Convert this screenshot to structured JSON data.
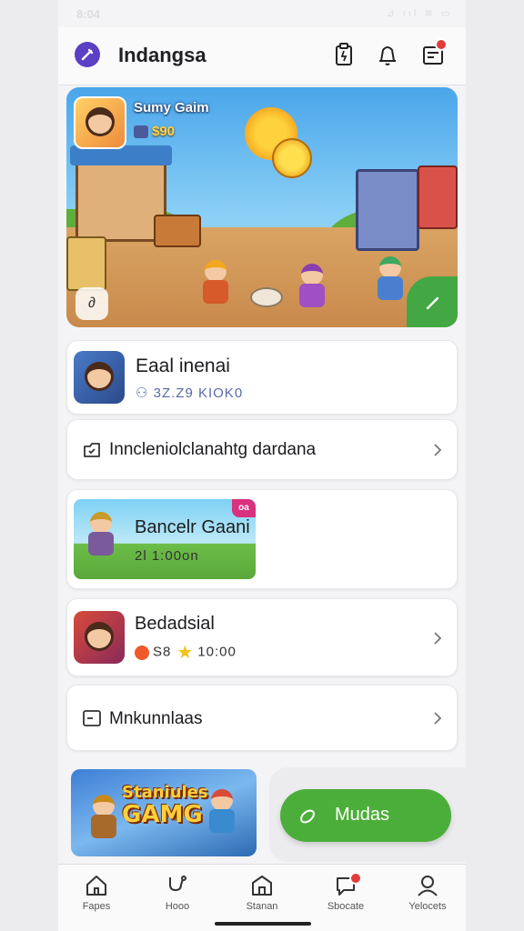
{
  "status_bar": {
    "time": "8:04",
    "icons": "⊿ ııl ≋ ▭"
  },
  "header": {
    "title": "Indangsa"
  },
  "hero": {
    "game_name": "Sumy Gaim",
    "score": "$90",
    "left_button_glyph": "∂"
  },
  "cards": {
    "profile": {
      "title": "Eaal inenai",
      "subtitle": "3Z.Z9 KIOK0"
    },
    "info_row": {
      "label": "Inncleniolclanahtg dardana"
    },
    "featured": {
      "title": "Bancelr Gaani",
      "subtitle": "2l 1:00on",
      "tag": "oa"
    },
    "game_item": {
      "title": "Bedadsial",
      "rating_prefix": "S8",
      "rating": "10:00"
    },
    "menu_row": {
      "label": "Mnkunnlaas"
    }
  },
  "promo": {
    "text_line1": "Staniules",
    "text_line2": "GAMG"
  },
  "action": {
    "label": "Mudas"
  },
  "tab_bar": {
    "items": [
      {
        "label": "Fapes"
      },
      {
        "label": "Hooo"
      },
      {
        "label": "Stanan"
      },
      {
        "label": "Sbocate"
      },
      {
        "label": "Yelocets"
      }
    ]
  },
  "colors": {
    "brand": "#5b3fc4",
    "accent_green": "#4cae3a",
    "badge_red": "#e23b3b"
  }
}
